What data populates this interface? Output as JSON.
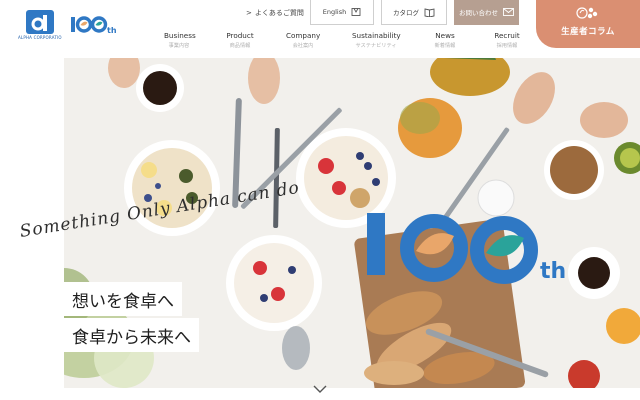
{
  "header": {
    "logo_text": "ALPHA CORPORATION",
    "faq_label": "よくあるご質問",
    "english_label": "English",
    "catalog_label": "カタログ",
    "contact_label": "お問い合わせ",
    "column_label": "生産者コラム",
    "nav": [
      {
        "en": "Business",
        "ja": "事業内容"
      },
      {
        "en": "Product",
        "ja": "商品情報"
      },
      {
        "en": "Company",
        "ja": "会社案内"
      },
      {
        "en": "Sustainability",
        "ja": "サステナビリティ"
      },
      {
        "en": "News",
        "ja": "新着情報"
      },
      {
        "en": "Recruit",
        "ja": "採用情報"
      }
    ]
  },
  "hero": {
    "script_text": "Something Only Alpha can do",
    "copy_line1": "想いを食卓へ",
    "copy_line2": "食卓から未来へ",
    "anniversary_number": "100",
    "anniversary_suffix": "th"
  },
  "colors": {
    "brand_blue": "#2f78c4",
    "brand_orange": "#e9a66a",
    "brand_teal": "#2aa39a",
    "contact_bg": "#b69f91",
    "column_bg": "#da8f72"
  },
  "icons": {
    "faq": "chevron-right-icon",
    "english": "globe-icon",
    "catalog": "book-icon",
    "contact": "mail-icon",
    "column": "leaf-icon",
    "scroll": "chevron-down-icon"
  }
}
